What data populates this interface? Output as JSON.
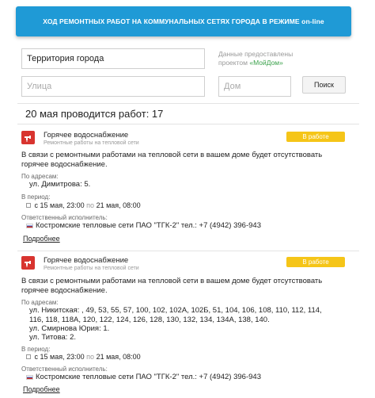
{
  "header": {
    "banner_text": "ХОД РЕМОНТНЫХ РАБОТ НА КОММУНАЛЬНЫХ СЕТЯХ ГОРОДА В РЕЖИМЕ on-line"
  },
  "search": {
    "territory_value": "Территория города",
    "street_placeholder": "Улица",
    "house_placeholder": "Дом",
    "search_label": "Поиск",
    "provided_by_text": "Данные предоставлены проектом",
    "provided_by_project": "«МойДом»"
  },
  "summary": {
    "text": "20 мая проводится работ: 17"
  },
  "works": [
    {
      "title": "Горячее водоснабжение",
      "subtitle": "Ремонтные работы на тепловой сети",
      "status": "В работе",
      "description": "В связи с ремонтными работами на тепловой сети в вашем доме будет отсутствовать горячее водоснабжение.",
      "addresses_label": "По адресам:",
      "addresses": [
        "ул. Димитрова: 5."
      ],
      "period_label": "В период:",
      "period_from_word": "с",
      "period_from": "15 мая, 23:00",
      "period_to_word": "по",
      "period_to": "21 мая, 08:00",
      "contractor_label": "Ответственный исполнитель:",
      "contractor": "Костромские тепловые сети ПАО \"ТГК-2\" тел.: +7 (4942) 396-943",
      "more_label": "Подробнее"
    },
    {
      "title": "Горячее водоснабжение",
      "subtitle": "Ремонтные работы на тепловой сети",
      "status": "В работе",
      "description": "В связи с ремонтными работами на тепловой сети в вашем доме будет отсутствовать горячее водоснабжение.",
      "addresses_label": "По адресам:",
      "addresses": [
        "ул. Никитская: , 49, 53, 55, 57, 100, 102, 102А, 102Б, 51, 104, 106, 108, 110, 112, 114,",
        "116, 118, 118А, 120, 122, 124, 126, 128, 130, 132, 134, 134А, 138, 140.",
        "ул. Смирнова Юрия: 1.",
        "ул. Титова: 2."
      ],
      "period_label": "В период:",
      "period_from_word": "с",
      "period_from": "15 мая, 23:00",
      "period_to_word": "по",
      "period_to": "21 мая, 08:00",
      "contractor_label": "Ответственный исполнитель:",
      "contractor": "Костромские тепловые сети ПАО \"ТГК-2\" тел.: +7 (4942) 396-943",
      "more_label": "Подробнее"
    }
  ],
  "colors": {
    "banner": "#1f9ad6",
    "status_badge": "#f5c518",
    "icon": "#d8342f",
    "project_link": "#3aa14b"
  },
  "icons": {
    "tap": "water-tap-icon",
    "calendar": "calendar-icon",
    "flag": "flag-icon"
  }
}
